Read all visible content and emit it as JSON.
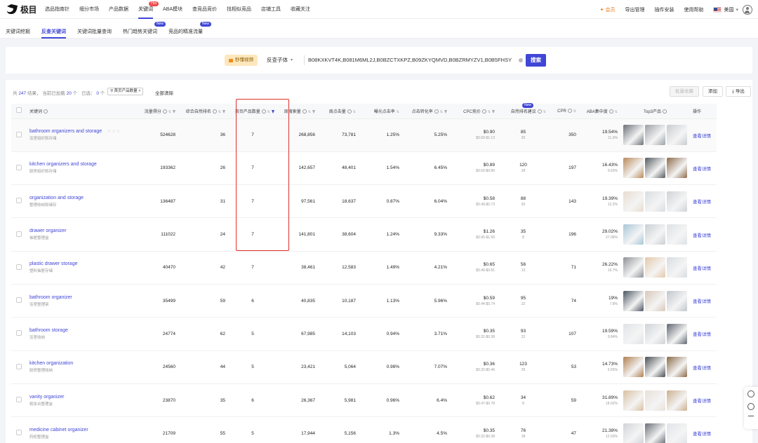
{
  "brand": {
    "name": "极目"
  },
  "nav": [
    "选品指南针",
    "细分市场",
    "产品数据",
    "关键词",
    "ABA模块",
    "查竞品竞价",
    "找相似竞品",
    "店铺工具",
    "收藏关注"
  ],
  "nav_hot_badge": "Hot",
  "top_right": {
    "vip": "会员",
    "export": "导出管理",
    "plugin": "插件安装",
    "help": "使用帮助",
    "country": "美国"
  },
  "subtabs": [
    "关键词挖掘",
    "反查关键词",
    "关键词批量查询",
    "热门趋势关键词",
    "竞品的精准流量"
  ],
  "new_badge": "New",
  "search": {
    "video_button": "秒懂视频",
    "select_value": "反查子体",
    "asin_value": "B08KXKVT4K,B081M6ML2J,B0BZCTXKPZ,B09ZKYQMVD,B0BZRMYZV1,B0B5FHSY",
    "button": "搜索"
  },
  "result_bar": {
    "total_prefix": "共",
    "total": "247",
    "total_suffix": "结果，",
    "loaded_prefix": "当前已加载",
    "loaded": "20",
    "loaded_suffix": "个",
    "selected_prefix": "已选：",
    "selected": "0",
    "selected_suffix": "个",
    "filter_tag": "首页产品数量",
    "clear_all": "全部清除",
    "batch_button": "批量收藏",
    "column_button": "添加",
    "export_button": "导出"
  },
  "columns": [
    "关键词",
    "流量得分",
    "综合自然排名",
    "首页产品数量",
    "周搜索量",
    "周点击量",
    "曝光点击率",
    "点击转化率",
    "CPC竞价",
    "自然排名建议",
    "CPR",
    "ABA集中度",
    "Top3产品",
    "操作"
  ],
  "detail_link": "查看详情",
  "rows": [
    {
      "kw": "bathroom organizers and storage",
      "kw_cn": "浴室组织和存储",
      "score": "524628",
      "rank": "36",
      "first_page": "7",
      "weekly_search": "268,856",
      "weekly_click": "73,781",
      "imp_ctr": "1.25%",
      "cvr": "5.25%",
      "cpc": "$0.90",
      "cpc_range": "$0.69-$1.13",
      "nat_rank": "85",
      "nat_rank_sub": "20",
      "cpr": "350",
      "aba": "19.54%",
      "aba_sub": "11.3%",
      "thumb_colors": [
        "#6b7078",
        "#9aa0a6",
        "#c8ccd0"
      ]
    },
    {
      "kw": "kitchen organizers and storage",
      "kw_cn": "厨房组织和存储",
      "score": "193362",
      "rank": "26",
      "first_page": "7",
      "weekly_search": "142,657",
      "weekly_click": "48,401",
      "imp_ctr": "1.54%",
      "cvr": "6.45%",
      "cpc": "$0.89",
      "cpc_range": "$0.69-$0.80",
      "nat_rank": "120",
      "nat_rank_sub": "28",
      "cpr": "197",
      "aba": "16.43%",
      "aba_sub": "9.63%",
      "thumb_colors": [
        "#b98a5a",
        "#555b60",
        "#8c6a4a"
      ]
    },
    {
      "kw": "organization and storage",
      "kw_cn": "整理收纳和储存",
      "score": "136487",
      "rank": "31",
      "first_page": "7",
      "weekly_search": "97,561",
      "weekly_click": "18,637",
      "imp_ctr": "0.87%",
      "cvr": "6.04%",
      "cpc": "$0.58",
      "cpc_range": "$0.49-$0.73",
      "nat_rank": "88",
      "nat_rank_sub": "20",
      "cpr": "143",
      "aba": "19.39%",
      "aba_sub": "12.2%",
      "thumb_colors": [
        "#e8dcd0",
        "#d9dde0",
        "#cfd3d6"
      ]
    },
    {
      "kw": "drawer organizer",
      "kw_cn": "抽屉整理盒",
      "score": "111022",
      "rank": "24",
      "first_page": "7",
      "weekly_search": "141,801",
      "weekly_click": "38,604",
      "imp_ctr": "1.24%",
      "cvr": "9.33%",
      "cpc": "$1.26",
      "cpc_range": "$0.95-$1.56",
      "nat_rank": "35",
      "nat_rank_sub": "8",
      "cpr": "196",
      "aba": "29.02%",
      "aba_sub": "27.06%",
      "thumb_colors": [
        "#a7c7d8",
        "#c9cfd4",
        "#dde2e5"
      ]
    },
    {
      "kw": "plastic drawer storage",
      "kw_cn": "塑料抽屉存储",
      "score": "40470",
      "rank": "42",
      "first_page": "7",
      "weekly_search": "38,461",
      "weekly_click": "12,583",
      "imp_ctr": "1.49%",
      "cvr": "4.21%",
      "cpc": "$0.65",
      "cpc_range": "$0.49-$0.81",
      "nat_rank": "56",
      "nat_rank_sub": "13",
      "cpr": "71",
      "aba": "26.22%",
      "aba_sub": "15.7%",
      "thumb_colors": [
        "#8e9296",
        "#e4c8a8",
        "#d8dde0"
      ]
    },
    {
      "kw": "bathroom organizer",
      "kw_cn": "浴室整理架",
      "score": "35499",
      "rank": "59",
      "first_page": "6",
      "weekly_search": "40,835",
      "weekly_click": "10,187",
      "imp_ctr": "1.13%",
      "cvr": "5.96%",
      "cpc": "$0.59",
      "cpc_range": "$0.44-$0.74",
      "nat_rank": "95",
      "nat_rank_sub": "22",
      "cpr": "74",
      "aba": "19%",
      "aba_sub": "7.8%",
      "thumb_colors": [
        "#4a5560",
        "#d8c8b8",
        "#c0c6cc"
      ]
    },
    {
      "kw": "bathroom storage",
      "kw_cn": "浴室收纳",
      "score": "24774",
      "rank": "62",
      "first_page": "5",
      "weekly_search": "67,985",
      "weekly_click": "14,103",
      "imp_ctr": "0.94%",
      "cvr": "3.71%",
      "cpc": "$0.35",
      "cpc_range": "$0.32-$0.38",
      "nat_rank": "93",
      "nat_rank_sub": "22",
      "cpr": "107",
      "aba": "19.59%",
      "aba_sub": "9.84%",
      "thumb_colors": [
        "#e0e3e6",
        "#cfd4d8",
        "#606870"
      ]
    },
    {
      "kw": "kitchen organization",
      "kw_cn": "厨房整理收纳",
      "score": "24560",
      "rank": "44",
      "first_page": "5",
      "weekly_search": "23,421",
      "weekly_click": "5,064",
      "imp_ctr": "0.98%",
      "cvr": "7.07%",
      "cpc": "$0.36",
      "cpc_range": "$0.32-$0.46",
      "nat_rank": "123",
      "nat_rank_sub": "29",
      "cpr": "53",
      "aba": "14.73%",
      "aba_sub": "6.55%",
      "thumb_colors": [
        "#b08050",
        "#4a4f54",
        "#8a6a48"
      ]
    },
    {
      "kw": "vanity organizer",
      "kw_cn": "梳妆台整理盒",
      "score": "23870",
      "rank": "35",
      "first_page": "6",
      "weekly_search": "26,367",
      "weekly_click": "5,981",
      "imp_ctr": "0.96%",
      "cvr": "6.4%",
      "cpc": "$0.62",
      "cpc_range": "$0.47-$0.78",
      "nat_rank": "34",
      "nat_rank_sub": "8",
      "cpr": "59",
      "aba": "31.89%",
      "aba_sub": "18.62%",
      "thumb_colors": [
        "#d8c0a0",
        "#e8e0d8",
        "#ccb090"
      ]
    },
    {
      "kw": "medicine cabinet organizer",
      "kw_cn": "药柜整理盒",
      "score": "21709",
      "rank": "55",
      "first_page": "5",
      "weekly_search": "17,944",
      "weekly_click": "5,156",
      "imp_ctr": "1.3%",
      "cvr": "4.5%",
      "cpc": "$0.35",
      "cpc_range": "$0.32-$0.38",
      "nat_rank": "76",
      "nat_rank_sub": "18",
      "cpr": "47",
      "aba": "21.38%",
      "aba_sub": "12.53%",
      "thumb_colors": [
        "#d0d4d8",
        "#6a7078",
        "#e0e4e8"
      ]
    }
  ]
}
